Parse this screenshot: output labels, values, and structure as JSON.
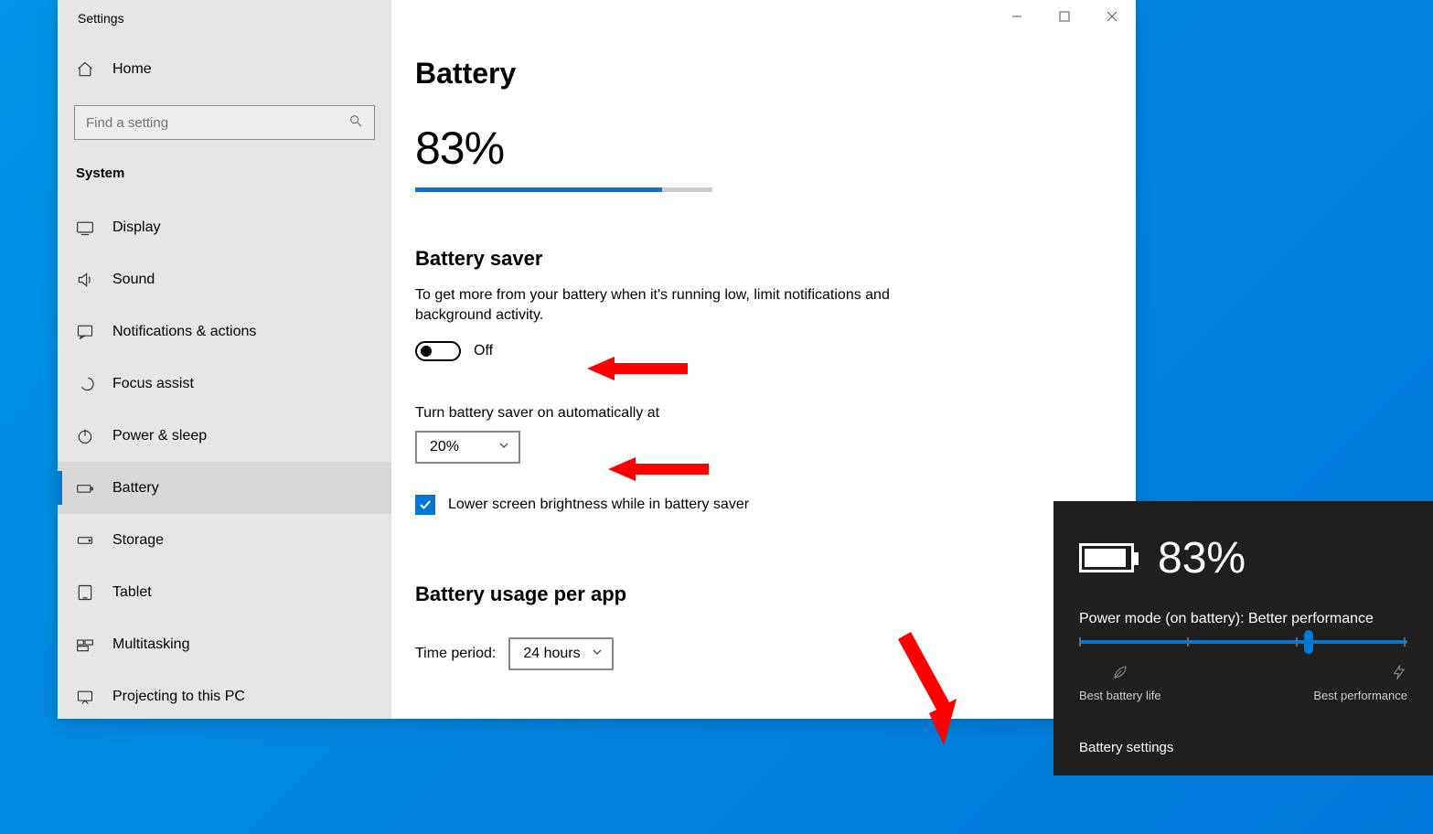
{
  "app_title": "Settings",
  "sidebar": {
    "home_label": "Home",
    "search_placeholder": "Find a setting",
    "category": "System",
    "items": [
      {
        "label": "Display",
        "icon": "display-icon"
      },
      {
        "label": "Sound",
        "icon": "sound-icon"
      },
      {
        "label": "Notifications & actions",
        "icon": "notifications-icon"
      },
      {
        "label": "Focus assist",
        "icon": "focus-assist-icon"
      },
      {
        "label": "Power & sleep",
        "icon": "power-icon"
      },
      {
        "label": "Battery",
        "icon": "battery-icon"
      },
      {
        "label": "Storage",
        "icon": "storage-icon"
      },
      {
        "label": "Tablet",
        "icon": "tablet-icon"
      },
      {
        "label": "Multitasking",
        "icon": "multitasking-icon"
      },
      {
        "label": "Projecting to this PC",
        "icon": "projecting-icon"
      }
    ],
    "active_index": 5
  },
  "main": {
    "title": "Battery",
    "battery_percent": "83%",
    "battery_fill_pct": 83,
    "saver_section_title": "Battery saver",
    "saver_desc": "To get more from your battery when it's running low, limit notifications and background activity.",
    "saver_toggle_state": "Off",
    "auto_on_label": "Turn battery saver on automatically at",
    "auto_on_value": "20%",
    "lower_brightness_label": "Lower screen brightness while in battery saver",
    "lower_brightness_checked": true,
    "usage_section_title": "Battery usage per app",
    "time_period_label": "Time period:",
    "time_period_value": "24 hours"
  },
  "flyout": {
    "percent": "83%",
    "fill_pct": 83,
    "mode_label": "Power mode (on battery): Better performance",
    "slider_pos_pct": 70,
    "left_end": "Best battery life",
    "right_end": "Best performance",
    "link": "Battery settings"
  }
}
